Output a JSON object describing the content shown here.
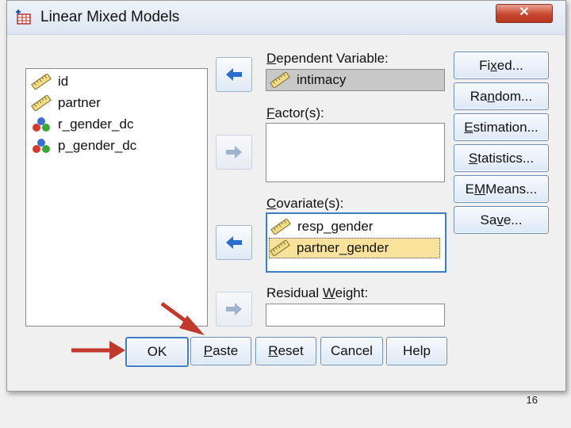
{
  "window": {
    "title": "Linear Mixed Models",
    "close_label": "✕"
  },
  "source_list": {
    "items": [
      {
        "label": "id",
        "icon": "ruler-icon"
      },
      {
        "label": "partner",
        "icon": "ruler-icon"
      },
      {
        "label": "r_gender_dc",
        "icon": "nominal-icon"
      },
      {
        "label": "p_gender_dc",
        "icon": "nominal-icon"
      }
    ]
  },
  "dependent": {
    "label_pre": "",
    "label_u": "D",
    "label_post": "ependent Variable:",
    "value": "intimacy"
  },
  "factors": {
    "label_pre": "",
    "label_u": "F",
    "label_post": "actor(s):"
  },
  "covariates": {
    "label_pre": "",
    "label_u": "C",
    "label_post": "ovariate(s):",
    "items": [
      {
        "label": "resp_gender"
      },
      {
        "label": "partner_gender"
      }
    ]
  },
  "residual_weight": {
    "label_pre": "Residual ",
    "label_u": "W",
    "label_post": "eight:"
  },
  "side_buttons": [
    {
      "pre": "Fi",
      "u": "x",
      "post": "ed..."
    },
    {
      "pre": "Ra",
      "u": "n",
      "post": "dom..."
    },
    {
      "pre": "",
      "u": "E",
      "post": "stimation..."
    },
    {
      "pre": "",
      "u": "S",
      "post": "tatistics..."
    },
    {
      "pre": "E",
      "u": "M",
      "post": " Means..."
    },
    {
      "pre": "Sa",
      "u": "v",
      "post": "e..."
    }
  ],
  "bottom_buttons": [
    {
      "pre": "OK",
      "u": "",
      "post": ""
    },
    {
      "pre": "",
      "u": "P",
      "post": "aste"
    },
    {
      "pre": "",
      "u": "R",
      "post": "eset"
    },
    {
      "pre": "Cancel",
      "u": "",
      "post": ""
    },
    {
      "pre": "Help",
      "u": "",
      "post": ""
    }
  ],
  "slide": {
    "page_number": "16"
  },
  "colors": {
    "selected_row": "#f9e39b",
    "dependent_bg": "#c8c8c8",
    "red_arrow": "#c0392b"
  }
}
